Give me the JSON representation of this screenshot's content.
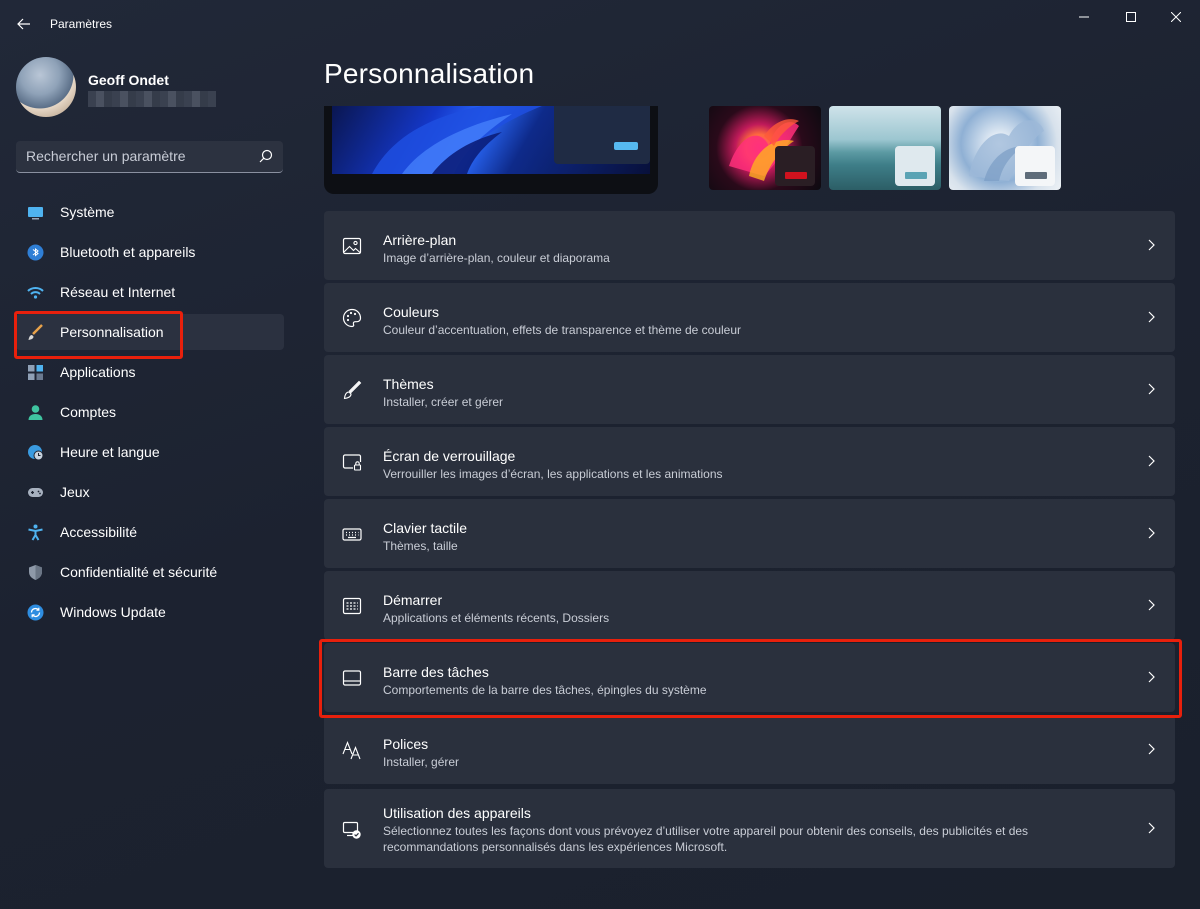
{
  "window": {
    "title": "Paramètres"
  },
  "profile": {
    "name": "Geoff Ondet"
  },
  "search": {
    "placeholder": "Rechercher un paramètre"
  },
  "nav": {
    "items": [
      {
        "label": "Système",
        "icon": "monitor-icon"
      },
      {
        "label": "Bluetooth et appareils",
        "icon": "bluetooth-icon"
      },
      {
        "label": "Réseau et Internet",
        "icon": "wifi-icon"
      },
      {
        "label": "Personnalisation",
        "icon": "brush-icon",
        "active": true
      },
      {
        "label": "Applications",
        "icon": "apps-icon"
      },
      {
        "label": "Comptes",
        "icon": "person-icon"
      },
      {
        "label": "Heure et langue",
        "icon": "globe-clock-icon"
      },
      {
        "label": "Jeux",
        "icon": "gamepad-icon"
      },
      {
        "label": "Accessibilité",
        "icon": "accessibility-icon"
      },
      {
        "label": "Confidentialité et sécurité",
        "icon": "shield-icon"
      },
      {
        "label": "Windows Update",
        "icon": "update-icon"
      }
    ]
  },
  "main": {
    "title": "Personnalisation",
    "cards": [
      {
        "title": "Arrière-plan",
        "subtitle": "Image d’arrière-plan, couleur et diaporama",
        "icon": "image-icon"
      },
      {
        "title": "Couleurs",
        "subtitle": "Couleur d’accentuation, effets de transparence et thème de couleur",
        "icon": "palette-icon"
      },
      {
        "title": "Thèmes",
        "subtitle": "Installer, créer et gérer",
        "icon": "brush-icon"
      },
      {
        "title": "Écran de verrouillage",
        "subtitle": "Verrouiller les images d’écran, les applications et les animations",
        "icon": "lock-screen-icon"
      },
      {
        "title": "Clavier tactile",
        "subtitle": "Thèmes, taille",
        "icon": "keyboard-icon"
      },
      {
        "title": "Démarrer",
        "subtitle": "Applications et éléments récents, Dossiers",
        "icon": "start-icon"
      },
      {
        "title": "Barre des tâches",
        "subtitle": "Comportements de la barre des tâches, épingles du système",
        "icon": "taskbar-icon"
      },
      {
        "title": "Polices",
        "subtitle": "Installer, gérer",
        "icon": "font-icon"
      },
      {
        "title": "Utilisation des appareils",
        "subtitle": "Sélectionnez toutes les façons dont vous prévoyez d’utiliser votre appareil pour obtenir des conseils, des publicités et des recommandations personnalisés dans les expériences Microsoft.",
        "icon": "device-usage-icon"
      }
    ]
  },
  "colors": {
    "highlight": "#e8200c",
    "accent": "#56b9f0"
  }
}
